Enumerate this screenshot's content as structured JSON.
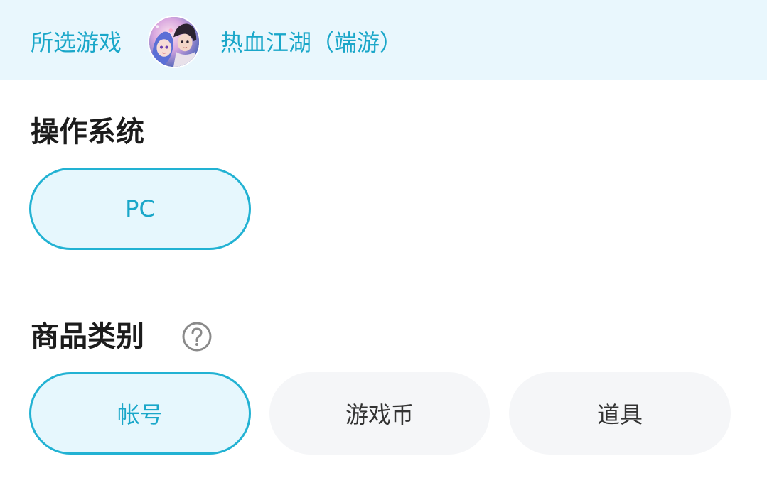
{
  "game_bar": {
    "label": "所选游戏",
    "game_name": "热血江湖（端游）",
    "avatar_icon": "game-avatar-image"
  },
  "os_section": {
    "title": "操作系统",
    "options": [
      {
        "label": "PC",
        "selected": true
      }
    ]
  },
  "category_section": {
    "title": "商品类别",
    "help_icon": "question-circle-icon",
    "options": [
      {
        "label": "帐号",
        "selected": true
      },
      {
        "label": "游戏币",
        "selected": false
      },
      {
        "label": "道具",
        "selected": false
      }
    ]
  },
  "colors": {
    "accent": "#1aa7c9",
    "accent_border": "#22b2d3",
    "selected_bg": "#e6f7fd",
    "header_bg": "#e9f7fd",
    "unselected_bg": "#f5f6f8",
    "title_text": "#1c1c1c"
  }
}
